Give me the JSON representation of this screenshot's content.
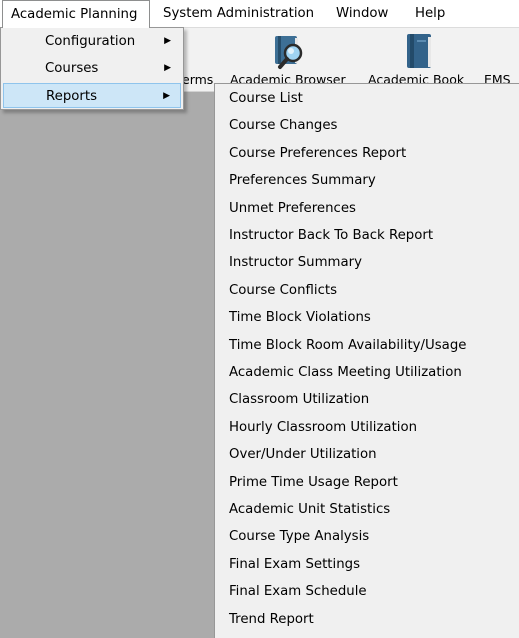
{
  "menubar": {
    "items": [
      {
        "label": "Academic Planning"
      },
      {
        "label": "System Administration"
      },
      {
        "label": "Window"
      },
      {
        "label": "Help"
      }
    ]
  },
  "toolbar": {
    "buttons": [
      {
        "label": "erms",
        "icon": "unknown-icon"
      },
      {
        "label": "Academic Browser",
        "icon": "book-magnifier-icon"
      },
      {
        "label": "Academic Book",
        "icon": "book-icon"
      },
      {
        "label": "EMS",
        "icon": "unknown-icon"
      }
    ]
  },
  "dropdown": {
    "items": [
      {
        "label": "Configuration",
        "arrow": "▶"
      },
      {
        "label": "Courses",
        "arrow": "▶"
      },
      {
        "label": "Reports",
        "arrow": "▶"
      }
    ]
  },
  "submenu": {
    "items": [
      {
        "label": "Course List"
      },
      {
        "label": "Course Changes"
      },
      {
        "label": "Course Preferences Report"
      },
      {
        "label": "Preferences Summary"
      },
      {
        "label": "Unmet Preferences"
      },
      {
        "label": "Instructor Back To Back Report"
      },
      {
        "label": "Instructor Summary"
      },
      {
        "label": "Course Conflicts"
      },
      {
        "label": "Time Block Violations"
      },
      {
        "label": "Time Block Room Availability/Usage"
      },
      {
        "label": "Academic Class Meeting Utilization"
      },
      {
        "label": "Classroom Utilization"
      },
      {
        "label": "Hourly Classroom Utilization"
      },
      {
        "label": "Over/Under Utilization"
      },
      {
        "label": "Prime Time Usage Report"
      },
      {
        "label": "Academic Unit Statistics"
      },
      {
        "label": "Course Type Analysis"
      },
      {
        "label": "Final Exam Settings"
      },
      {
        "label": "Final Exam Schedule"
      },
      {
        "label": "Trend Report"
      }
    ]
  },
  "colors": {
    "workspace_bg": "#ababab",
    "menu_bg": "#f0f0f0",
    "highlight_bg": "#cde6f7",
    "highlight_border": "#8fc4ec"
  }
}
